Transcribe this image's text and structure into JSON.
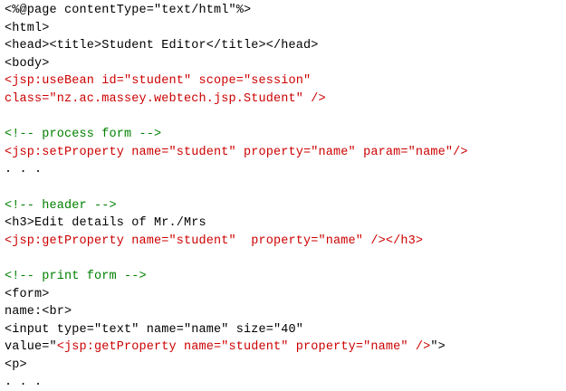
{
  "colors": {
    "text": "#000000",
    "jsp_tag": "#cc0000",
    "comment": "#008000",
    "background": "#ffffff"
  },
  "lines": [
    [
      {
        "t": "<%@page contentType=\"text/html\"%>",
        "c": "black"
      }
    ],
    [
      {
        "t": "<html>",
        "c": "black"
      }
    ],
    [
      {
        "t": "<head><title>Student Editor</title></head>",
        "c": "black"
      }
    ],
    [
      {
        "t": "<body>",
        "c": "black"
      }
    ],
    [
      {
        "t": "<jsp:useBean id=\"student\" scope=\"session\"",
        "c": "red"
      }
    ],
    [
      {
        "t": "class=\"nz.ac.massey.webtech.jsp.Student\" />",
        "c": "red"
      }
    ],
    [],
    [
      {
        "t": "<!-- process form -->",
        "c": "green"
      }
    ],
    [
      {
        "t": "<jsp:setProperty name=\"student\" property=\"name\" param=\"name\"/>",
        "c": "red"
      }
    ],
    [
      {
        "t": ". . .",
        "c": "black"
      }
    ],
    [],
    [
      {
        "t": "<!-- header -->",
        "c": "green"
      }
    ],
    [
      {
        "t": "<h3>Edit details of Mr./Mrs",
        "c": "black"
      }
    ],
    [
      {
        "t": "<jsp:getProperty name=\"student\"  property=\"name\" /></h3>",
        "c": "red"
      }
    ],
    [],
    [
      {
        "t": "<!-- print form -->",
        "c": "green"
      }
    ],
    [
      {
        "t": "<form>",
        "c": "black"
      }
    ],
    [
      {
        "t": "name:<br>",
        "c": "black"
      }
    ],
    [
      {
        "t": "<input type=\"text\" name=\"name\" size=\"40\"",
        "c": "black"
      }
    ],
    [
      {
        "t": "value=\"",
        "c": "black"
      },
      {
        "t": "<jsp:getProperty name=\"student\" property=\"name\" />",
        "c": "red"
      },
      {
        "t": "\">",
        "c": "black"
      }
    ],
    [
      {
        "t": "<p>",
        "c": "black"
      }
    ],
    [
      {
        "t": ". . .",
        "c": "black"
      }
    ]
  ]
}
